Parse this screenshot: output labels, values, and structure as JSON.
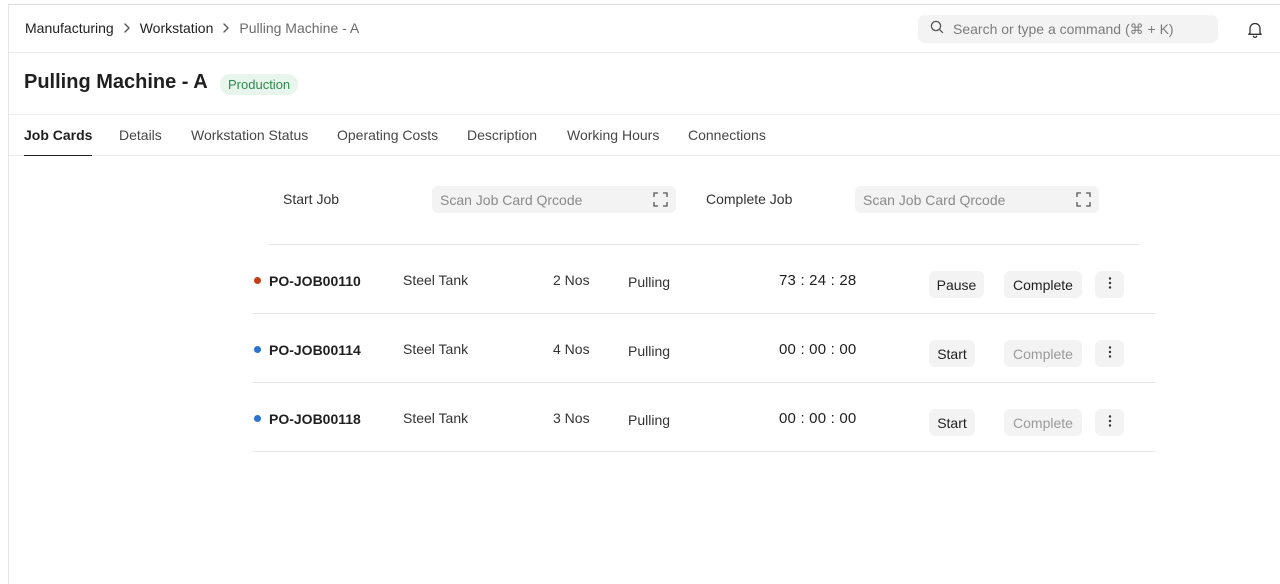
{
  "breadcrumb": {
    "items": [
      "Manufacturing",
      "Workstation",
      "Pulling Machine - A"
    ]
  },
  "search": {
    "placeholder": "Search or type a command (⌘ + K)"
  },
  "page": {
    "title": "Pulling Machine - A",
    "status": "Production"
  },
  "tabs": [
    "Job Cards",
    "Details",
    "Workstation Status",
    "Operating Costs",
    "Description",
    "Working Hours",
    "Connections"
  ],
  "scan": {
    "start_label": "Start Job",
    "start_placeholder": "Scan Job Card Qrcode",
    "complete_label": "Complete Job",
    "complete_placeholder": "Scan Job Card Qrcode"
  },
  "jobs": [
    {
      "id": "PO-JOB00110",
      "item": "Steel Tank",
      "qty": "2 Nos",
      "operation": "Pulling",
      "timer": "73 : 24 : 28",
      "status_color": "#c43c16",
      "action": "Pause",
      "complete": "Complete",
      "complete_enabled": true
    },
    {
      "id": "PO-JOB00114",
      "item": "Steel Tank",
      "qty": "4 Nos",
      "operation": "Pulling",
      "timer": "00 : 00 : 00",
      "status_color": "#2b73cc",
      "action": "Start",
      "complete": "Complete",
      "complete_enabled": false
    },
    {
      "id": "PO-JOB00118",
      "item": "Steel Tank",
      "qty": "3 Nos",
      "operation": "Pulling",
      "timer": "00 : 00 : 00",
      "status_color": "#2b73cc",
      "action": "Start",
      "complete": "Complete",
      "complete_enabled": false
    }
  ],
  "icons": {
    "search": "search-icon",
    "bell": "bell-icon",
    "chevron": "chevron-right-icon",
    "scan": "scan-frame-icon",
    "more": "more-vertical-icon"
  }
}
